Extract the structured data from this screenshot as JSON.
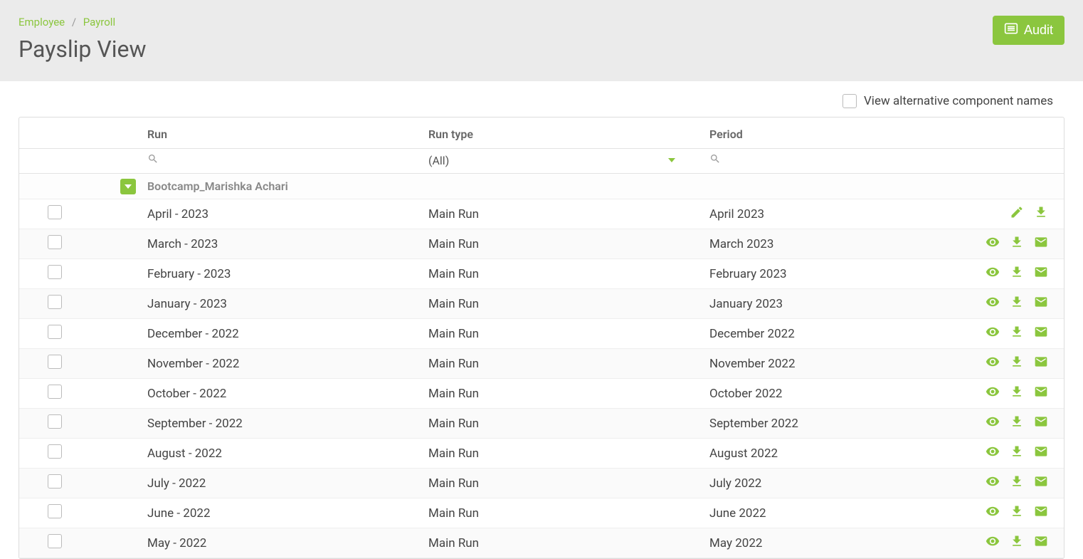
{
  "breadcrumb": {
    "item1": "Employee",
    "item2": "Payroll"
  },
  "page_title": "Payslip View",
  "audit_button": "Audit",
  "view_alt_label": "View alternative component names",
  "columns": {
    "run": "Run",
    "run_type": "Run type",
    "period": "Period"
  },
  "run_type_filter": "(All)",
  "group_name": "Bootcamp_Marishka Achari",
  "rows": [
    {
      "run": "April - 2023",
      "run_type": "Main Run",
      "period": "April 2023",
      "actions": [
        "edit",
        "download"
      ]
    },
    {
      "run": "March - 2023",
      "run_type": "Main Run",
      "period": "March 2023",
      "actions": [
        "view",
        "download",
        "mail"
      ]
    },
    {
      "run": "February - 2023",
      "run_type": "Main Run",
      "period": "February 2023",
      "actions": [
        "view",
        "download",
        "mail"
      ]
    },
    {
      "run": "January - 2023",
      "run_type": "Main Run",
      "period": "January 2023",
      "actions": [
        "view",
        "download",
        "mail"
      ]
    },
    {
      "run": "December - 2022",
      "run_type": "Main Run",
      "period": "December 2022",
      "actions": [
        "view",
        "download",
        "mail"
      ]
    },
    {
      "run": "November - 2022",
      "run_type": "Main Run",
      "period": "November 2022",
      "actions": [
        "view",
        "download",
        "mail"
      ]
    },
    {
      "run": "October - 2022",
      "run_type": "Main Run",
      "period": "October 2022",
      "actions": [
        "view",
        "download",
        "mail"
      ]
    },
    {
      "run": "September - 2022",
      "run_type": "Main Run",
      "period": "September 2022",
      "actions": [
        "view",
        "download",
        "mail"
      ]
    },
    {
      "run": "August - 2022",
      "run_type": "Main Run",
      "period": "August 2022",
      "actions": [
        "view",
        "download",
        "mail"
      ]
    },
    {
      "run": "July - 2022",
      "run_type": "Main Run",
      "period": "July 2022",
      "actions": [
        "view",
        "download",
        "mail"
      ]
    },
    {
      "run": "June - 2022",
      "run_type": "Main Run",
      "period": "June 2022",
      "actions": [
        "view",
        "download",
        "mail"
      ]
    },
    {
      "run": "May - 2022",
      "run_type": "Main Run",
      "period": "May 2022",
      "actions": [
        "view",
        "download",
        "mail"
      ]
    }
  ]
}
